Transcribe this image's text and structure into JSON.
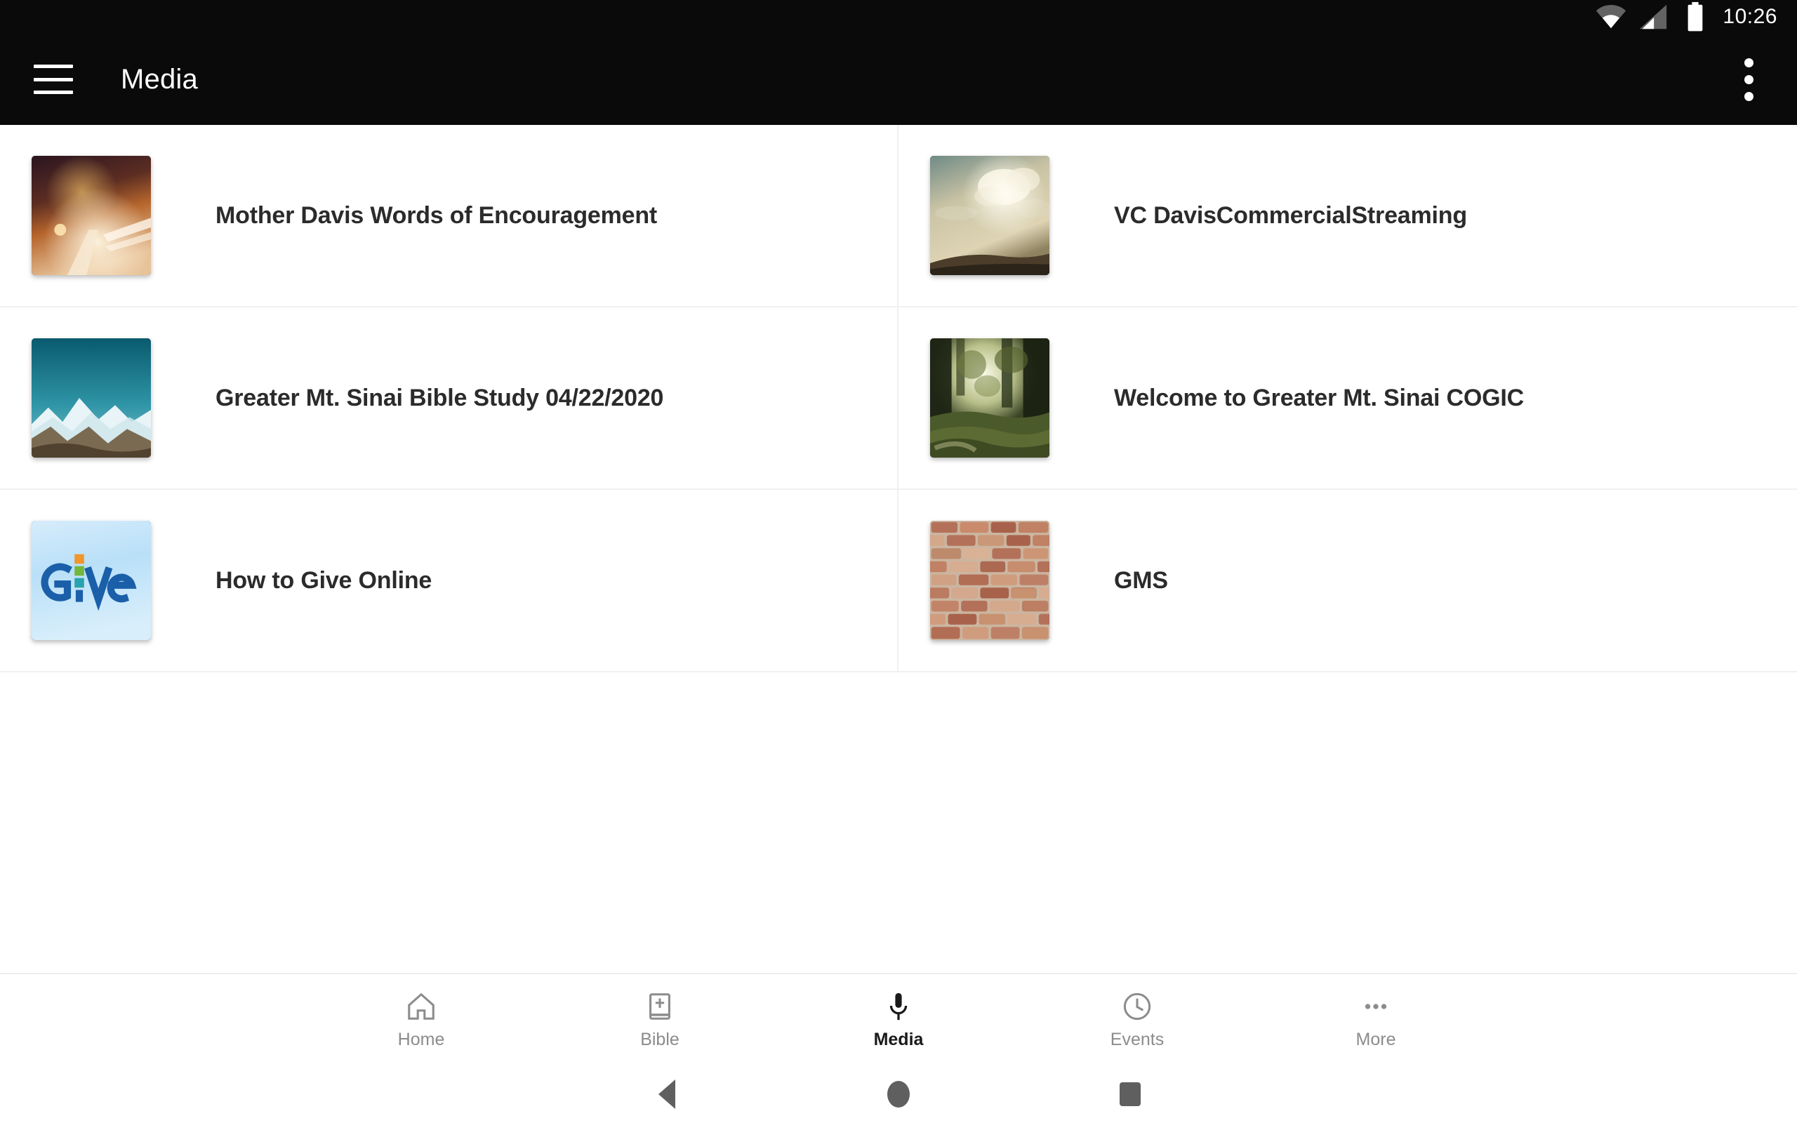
{
  "status_bar": {
    "time": "10:26",
    "icons": [
      "wifi-icon",
      "cellular-signal-icon",
      "battery-icon"
    ]
  },
  "app_bar": {
    "menu_icon": "hamburger-menu-icon",
    "title": "Media",
    "overflow_icon": "overflow-menu-icon"
  },
  "media_items": [
    {
      "title": "Mother Davis Words of Encouragement",
      "thumbnail": "night-highway-light-trails"
    },
    {
      "title": "VC DavisCommercialStreaming",
      "thumbnail": "golden-sky-clouds-hill"
    },
    {
      "title": "Greater Mt. Sinai Bible Study 04/22/2020",
      "thumbnail": "teal-sky-snowy-mountains"
    },
    {
      "title": "Welcome to Greater Mt. Sinai COGIC",
      "thumbnail": "sunlit-forest-clearing"
    },
    {
      "title": "How to Give Online",
      "thumbnail": "give-logo-blue-gradient"
    },
    {
      "title": "GMS",
      "thumbnail": "red-brick-wall"
    }
  ],
  "bottom_nav": {
    "active": "Media",
    "items": [
      {
        "label": "Home",
        "icon": "home-icon"
      },
      {
        "label": "Bible",
        "icon": "bible-book-icon"
      },
      {
        "label": "Media",
        "icon": "microphone-icon"
      },
      {
        "label": "Events",
        "icon": "clock-icon"
      },
      {
        "label": "More",
        "icon": "more-dots-icon"
      }
    ]
  },
  "system_nav": {
    "back": "back-button",
    "home": "home-button",
    "recents": "recents-button"
  },
  "colors": {
    "app_bar_bg": "#0a0a0a",
    "page_bg": "#ffffff",
    "divider": "#f0f0f0",
    "title_text": "#2b2b2b",
    "nav_inactive": "#8c8c8c",
    "nav_active": "#1a1a1a"
  }
}
